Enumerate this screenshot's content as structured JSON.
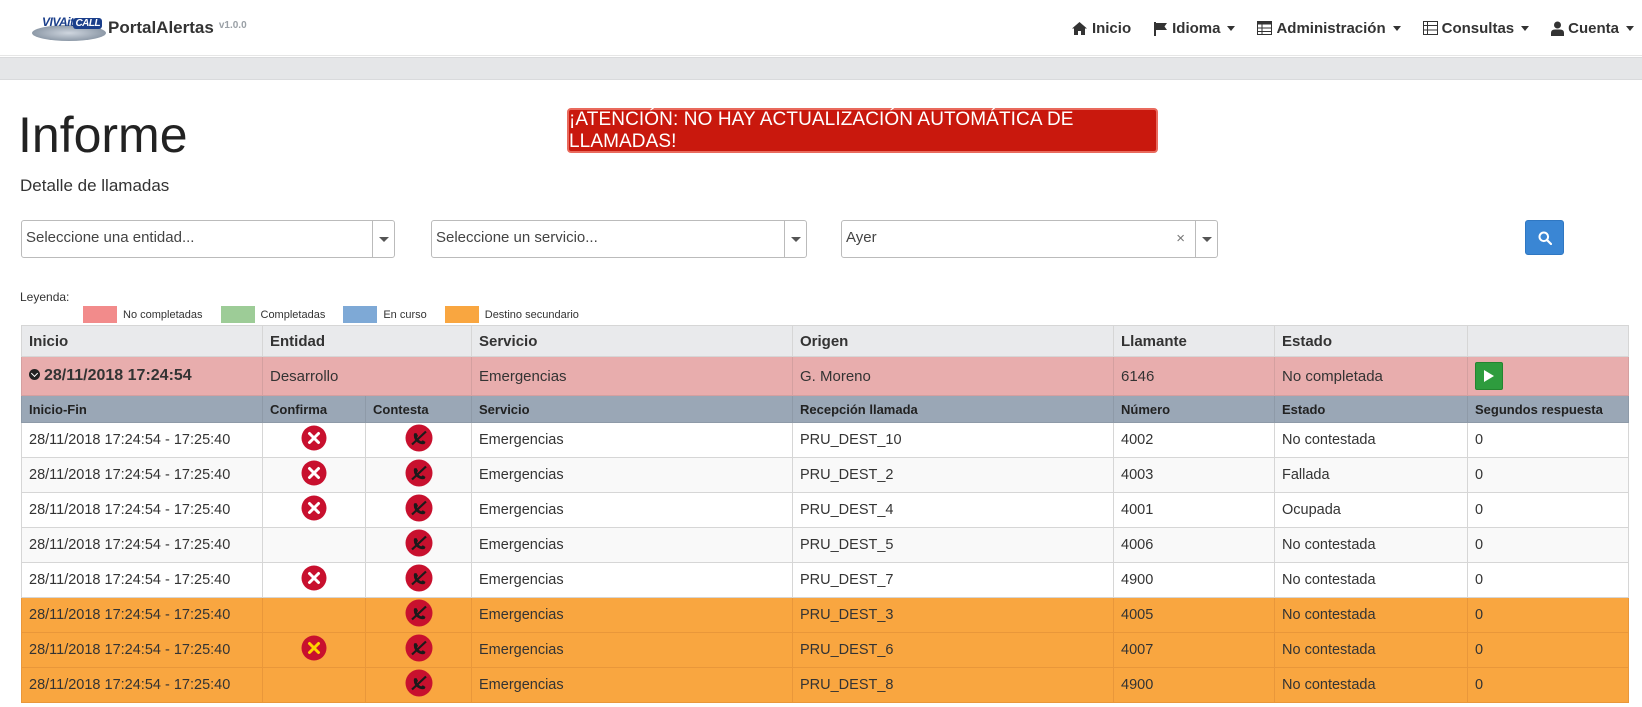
{
  "app": {
    "logo_text": "VIVAit",
    "logo_call": "CALL",
    "name": "PortalAlertas",
    "version": "v1.0.0"
  },
  "nav": [
    {
      "label": "Inicio",
      "icon": "home-icon",
      "caret": false
    },
    {
      "label": "Idioma",
      "icon": "flag-icon",
      "caret": true
    },
    {
      "label": "Administración",
      "icon": "table-icon",
      "caret": true
    },
    {
      "label": "Consultas",
      "icon": "list-icon",
      "caret": true
    },
    {
      "label": "Cuenta",
      "icon": "user-icon",
      "caret": true
    }
  ],
  "page": {
    "title": "Informe",
    "subtitle": "Detalle de llamadas",
    "alert": "¡ATENCIÓN: NO HAY ACTUALIZACIÓN AUTOMÁTICA DE LLAMADAS!"
  },
  "filters": {
    "entity_placeholder": "Seleccione una entidad...",
    "service_placeholder": "Seleccione un servicio...",
    "date_value": "Ayer",
    "clear_symbol": "×"
  },
  "legend": {
    "title": "Leyenda:",
    "items": [
      {
        "label": "No completadas",
        "color": "#f28b8b"
      },
      {
        "label": "Completadas",
        "color": "#9dcc97"
      },
      {
        "label": "En curso",
        "color": "#7ea9d6"
      },
      {
        "label": "Destino secundario",
        "color": "#f9a640"
      }
    ]
  },
  "table": {
    "headers": [
      "Inicio",
      "Entidad",
      "Servicio",
      "Origen",
      "Llamante",
      "Estado"
    ],
    "call": {
      "inicio": "28/11/2018 17:24:54",
      "entidad": "Desarrollo",
      "servicio": "Emergencias",
      "origen": "G. Moreno",
      "llamante": "6146",
      "estado": "No completada"
    },
    "detail_headers": [
      "Inicio-Fin",
      "Confirma",
      "Contesta",
      "Servicio",
      "Recepción llamada",
      "Número",
      "Estado",
      "Segundos respuesta"
    ],
    "detail_rows": [
      {
        "inicio_fin": "28/11/2018 17:24:54 - 17:25:40",
        "confirma": "x",
        "contesta": "hangup",
        "servicio": "Emergencias",
        "recepcion": "PRU_DEST_10",
        "numero": "4002",
        "estado": "No contestada",
        "segundos": "0",
        "secondary": false
      },
      {
        "inicio_fin": "28/11/2018 17:24:54 - 17:25:40",
        "confirma": "x",
        "contesta": "hangup",
        "servicio": "Emergencias",
        "recepcion": "PRU_DEST_2",
        "numero": "4003",
        "estado": "Fallada",
        "segundos": "0",
        "secondary": false
      },
      {
        "inicio_fin": "28/11/2018 17:24:54 - 17:25:40",
        "confirma": "x",
        "contesta": "hangup",
        "servicio": "Emergencias",
        "recepcion": "PRU_DEST_4",
        "numero": "4001",
        "estado": "Ocupada",
        "segundos": "0",
        "secondary": false
      },
      {
        "inicio_fin": "28/11/2018 17:24:54 - 17:25:40",
        "confirma": "",
        "contesta": "hangup",
        "servicio": "Emergencias",
        "recepcion": "PRU_DEST_5",
        "numero": "4006",
        "estado": "No contestada",
        "segundos": "0",
        "secondary": false
      },
      {
        "inicio_fin": "28/11/2018 17:24:54 - 17:25:40",
        "confirma": "x",
        "contesta": "hangup",
        "servicio": "Emergencias",
        "recepcion": "PRU_DEST_7",
        "numero": "4900",
        "estado": "No contestada",
        "segundos": "0",
        "secondary": false
      },
      {
        "inicio_fin": "28/11/2018 17:24:54 - 17:25:40",
        "confirma": "",
        "contesta": "hangup",
        "servicio": "Emergencias",
        "recepcion": "PRU_DEST_3",
        "numero": "4005",
        "estado": "No contestada",
        "segundos": "0",
        "secondary": true
      },
      {
        "inicio_fin": "28/11/2018 17:24:54 - 17:25:40",
        "confirma": "x-yellow",
        "contesta": "hangup",
        "servicio": "Emergencias",
        "recepcion": "PRU_DEST_6",
        "numero": "4007",
        "estado": "No contestada",
        "segundos": "0",
        "secondary": true
      },
      {
        "inicio_fin": "28/11/2018 17:24:54 - 17:25:40",
        "confirma": "",
        "contesta": "hangup",
        "servicio": "Emergencias",
        "recepcion": "PRU_DEST_8",
        "numero": "4900",
        "estado": "No contestada",
        "segundos": "0",
        "secondary": true
      }
    ]
  },
  "colors": {
    "alert": "#c9180d",
    "secondary_row": "#f9a640",
    "main_row": "#e8adad",
    "search_button": "#3a86d4",
    "play_button": "#2e9c3e"
  }
}
